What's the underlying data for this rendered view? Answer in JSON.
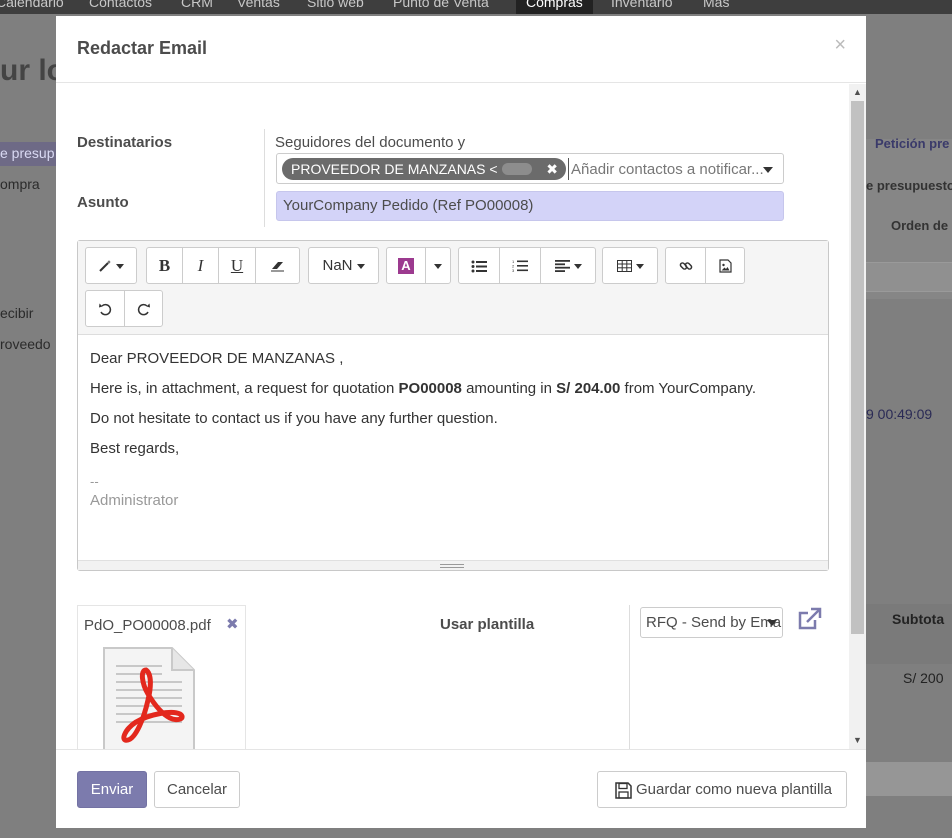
{
  "background": {
    "nav_items": [
      "Calendario",
      "Contactos",
      "CRM",
      "Ventas",
      "Sitio web",
      "Punto de Venta",
      "Compras",
      "Inventario",
      "Más"
    ],
    "title_fragment": "ur lo",
    "left_texts": [
      "e presup",
      "ompra",
      "ecibir",
      "roveedo"
    ],
    "right_texts": [
      "Petición pre",
      "e presupuesto",
      "Orden de",
      "9 00:49:09",
      "Subtota",
      "S/ 200"
    ]
  },
  "modal": {
    "title": "Redactar Email",
    "close_glyph": "×",
    "recipients": {
      "label": "Destinatarios",
      "followers_text": "Seguidores del documento y",
      "tag_text": "PROVEEDOR DE MANZANAS <",
      "placeholder": "Añadir contactos a notificar..."
    },
    "subject": {
      "label": "Asunto",
      "value": "YourCompany Pedido (Ref PO00008)"
    },
    "toolbar": {
      "font_size_label": "NaN",
      "bold": "B",
      "italic": "I",
      "underline": "U",
      "color_letter": "A"
    },
    "body": {
      "greeting": "Dear PROVEEDOR DE MANZANAS ,",
      "line2_pre": "Here is, in attachment, a request for quotation ",
      "line2_ref": "PO00008",
      "line2_mid": " amounting in ",
      "line2_amount": "S/ 204.00",
      "line2_post": " from YourCompany.",
      "line3": "Do not hesitate to contact us if you have any further question.",
      "closing": "Best regards,",
      "sig_dash": "--",
      "sig_name": "Administrator"
    },
    "attachment": {
      "filename": "PdO_PO00008.pdf",
      "remove_glyph": "✖"
    },
    "template": {
      "label": "Usar plantilla",
      "selected": "RFQ - Send by Email"
    },
    "footer": {
      "send": "Enviar",
      "cancel": "Cancelar",
      "save_template": "Guardar como nueva plantilla"
    }
  },
  "colors": {
    "primary": "#7c7bad",
    "subject_bg": "#d3d3f8",
    "tag_bg": "#6b6b6b"
  }
}
